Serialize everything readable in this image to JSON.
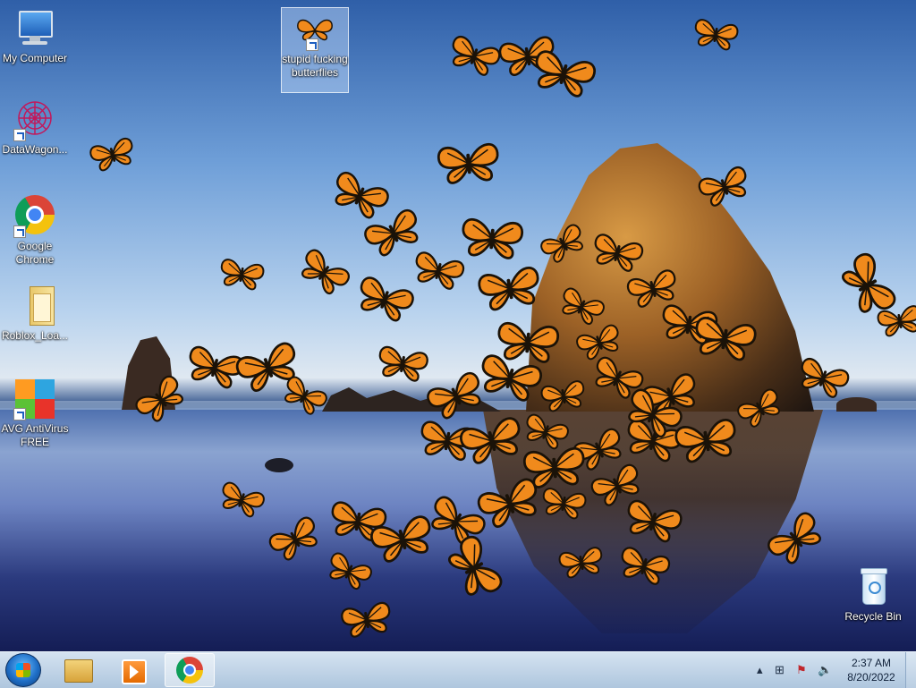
{
  "desktop": {
    "icons": [
      {
        "label": "My Computer",
        "icon": "computer-icon"
      },
      {
        "label": "stupid fucking butterflies",
        "icon": "butterfly-icon"
      },
      {
        "label": "DataWagon...",
        "icon": "spiral-icon"
      },
      {
        "label": "Google Chrome",
        "icon": "chrome-icon"
      },
      {
        "label": "Roblox_Loa...",
        "icon": "folder-icon"
      },
      {
        "label": "AVG AntiVirus FREE",
        "icon": "avg-icon"
      },
      {
        "label": "Recycle Bin",
        "icon": "recycle-bin-icon"
      }
    ]
  },
  "taskbar": {
    "start_icon": "windows-orb-icon",
    "pinned": [
      {
        "name": "Windows Explorer",
        "icon": "folder-icon"
      },
      {
        "name": "Windows Media Player",
        "icon": "media-player-icon"
      },
      {
        "name": "Google Chrome",
        "icon": "chrome-icon",
        "active": true
      }
    ],
    "tray_icons": [
      "show-hidden-icons-arrow",
      "network-icon",
      "action-center-flag-icon",
      "volume-icon"
    ],
    "time": "2:37 AM",
    "date": "8/20/2022"
  },
  "colors": {
    "butterfly_orange": "#f08a1c",
    "butterfly_black": "#1a1208",
    "taskbar": "#c3d6ea"
  }
}
